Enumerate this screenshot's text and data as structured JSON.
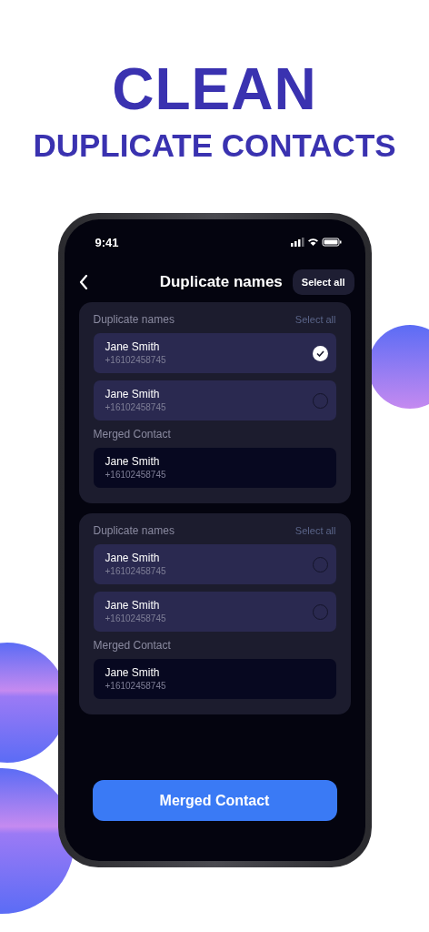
{
  "headline": {
    "title": "CLEAN",
    "subtitle": "DUPLICATE CONTACTS"
  },
  "status_bar": {
    "time": "9:41"
  },
  "header": {
    "title": "Duplicate names",
    "action": "Select all"
  },
  "groups": [
    {
      "label": "Duplicate names",
      "action": "Select all",
      "contacts": [
        {
          "name": "Jane Smith",
          "phone": "+16102458745",
          "checked": true
        },
        {
          "name": "Jane Smith",
          "phone": "+16102458745",
          "checked": false
        }
      ],
      "merged_label": "Merged Contact",
      "merged": {
        "name": "Jane Smith",
        "phone": "+16102458745"
      }
    },
    {
      "label": "Duplicate names",
      "action": "Select all",
      "contacts": [
        {
          "name": "Jane Smith",
          "phone": "+16102458745",
          "checked": false
        },
        {
          "name": "Jane Smith",
          "phone": "+16102458745",
          "checked": false
        }
      ],
      "merged_label": "Merged Contact",
      "merged": {
        "name": "Jane Smith",
        "phone": "+16102458745"
      }
    }
  ],
  "button": "Merged Contact"
}
